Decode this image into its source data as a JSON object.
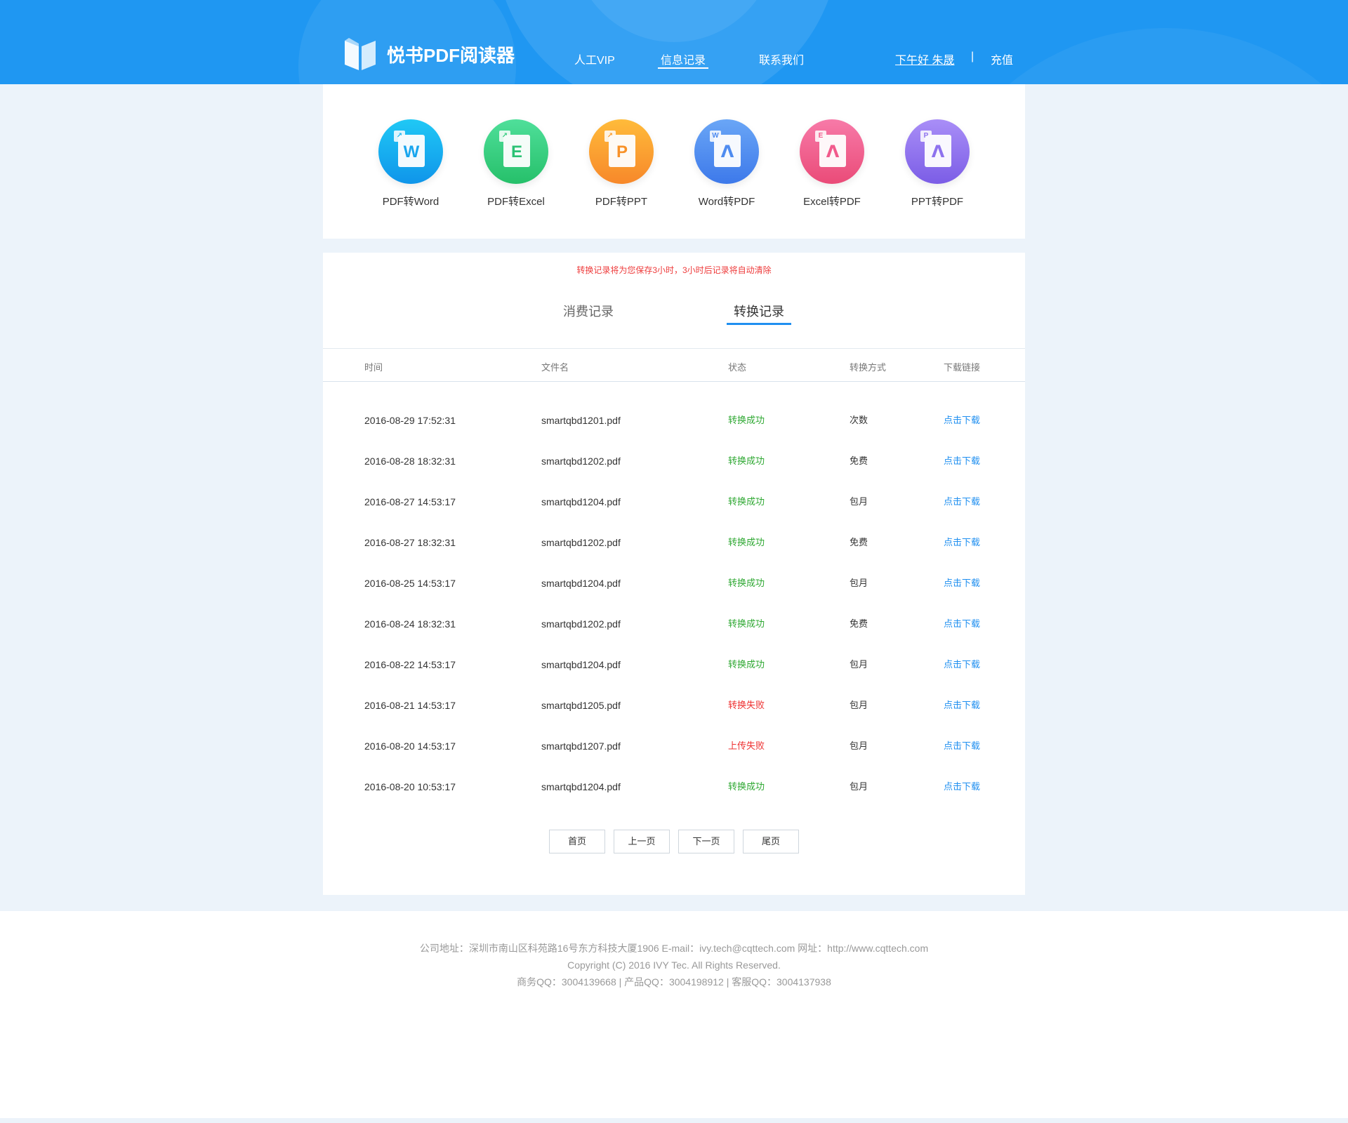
{
  "header": {
    "app_name": "悦书PDF阅读器",
    "nav": [
      "人工VIP",
      "信息记录",
      "联系我们"
    ],
    "active_nav": "信息记录",
    "greeting": "下午好 朱晟",
    "separator": "|",
    "recharge": "充值"
  },
  "tools": [
    {
      "label": "PDF转Word",
      "glyph": "W",
      "color": "#1bb6f0"
    },
    {
      "label": "PDF转Excel",
      "glyph": "E",
      "color": "#35cc80"
    },
    {
      "label": "PDF转PPT",
      "glyph": "P",
      "color": "#fb9b2c"
    },
    {
      "label": "Word转PDF",
      "glyph": "W",
      "color": "#4f8cf0"
    },
    {
      "label": "Excel转PDF",
      "glyph": "E",
      "color": "#f25a8c"
    },
    {
      "label": "PPT转PDF",
      "glyph": "P",
      "color": "#8e72ee"
    }
  ],
  "records": {
    "notice": "转换记录将为您保存3小时，3小时后记录将自动清除",
    "tabs": [
      "消费记录",
      "转换记录"
    ],
    "active_tab": "转换记录",
    "columns": [
      "时间",
      "文件名",
      "状态",
      "转换方式",
      "下载链接"
    ],
    "rows": [
      {
        "time": "2016-08-29  17:52:31",
        "file": "smartqbd1201.pdf",
        "status": "转换成功",
        "ok": true,
        "mode": "次数",
        "link": "点击下载"
      },
      {
        "time": "2016-08-28  18:32:31",
        "file": "smartqbd1202.pdf",
        "status": "转换成功",
        "ok": true,
        "mode": "免费",
        "link": "点击下载"
      },
      {
        "time": "2016-08-27  14:53:17",
        "file": "smartqbd1204.pdf",
        "status": "转换成功",
        "ok": true,
        "mode": "包月",
        "link": "点击下载"
      },
      {
        "time": "2016-08-27  18:32:31",
        "file": "smartqbd1202.pdf",
        "status": "转换成功",
        "ok": true,
        "mode": "免费",
        "link": "点击下载"
      },
      {
        "time": "2016-08-25  14:53:17",
        "file": "smartqbd1204.pdf",
        "status": "转换成功",
        "ok": true,
        "mode": "包月",
        "link": "点击下载"
      },
      {
        "time": "2016-08-24  18:32:31",
        "file": "smartqbd1202.pdf",
        "status": "转换成功",
        "ok": true,
        "mode": "免费",
        "link": "点击下载"
      },
      {
        "time": "2016-08-22  14:53:17",
        "file": "smartqbd1204.pdf",
        "status": "转换成功",
        "ok": true,
        "mode": "包月",
        "link": "点击下载"
      },
      {
        "time": "2016-08-21  14:53:17",
        "file": "smartqbd1205.pdf",
        "status": "转换失败",
        "ok": false,
        "mode": "包月",
        "link": "点击下载"
      },
      {
        "time": "2016-08-20  14:53:17",
        "file": "smartqbd1207.pdf",
        "status": "上传失败",
        "ok": false,
        "mode": "包月",
        "link": "点击下载"
      },
      {
        "time": "2016-08-20  10:53:17",
        "file": "smartqbd1204.pdf",
        "status": "转换成功",
        "ok": true,
        "mode": "包月",
        "link": "点击下载"
      }
    ],
    "pager": [
      "首页",
      "上一页",
      "下一页",
      "尾页"
    ]
  },
  "footer": {
    "line1": "公司地址：深圳市南山区科苑路16号东方科技大厦1906   E-mail：ivy.tech@cqttech.com   网址：http://www.cqttech.com",
    "line2": "Copyright (C) 2016 IVY Tec. All Rights Reserved.",
    "line3": "商务QQ：3004139668 | 产品QQ：3004198912 | 客服QQ：3004137938"
  },
  "colors": {
    "header_bg": "#1f97f2",
    "accent": "#1f8ff0",
    "success": "#2ea832",
    "error": "#ee3030",
    "page_bg": "#ecf3fa"
  }
}
